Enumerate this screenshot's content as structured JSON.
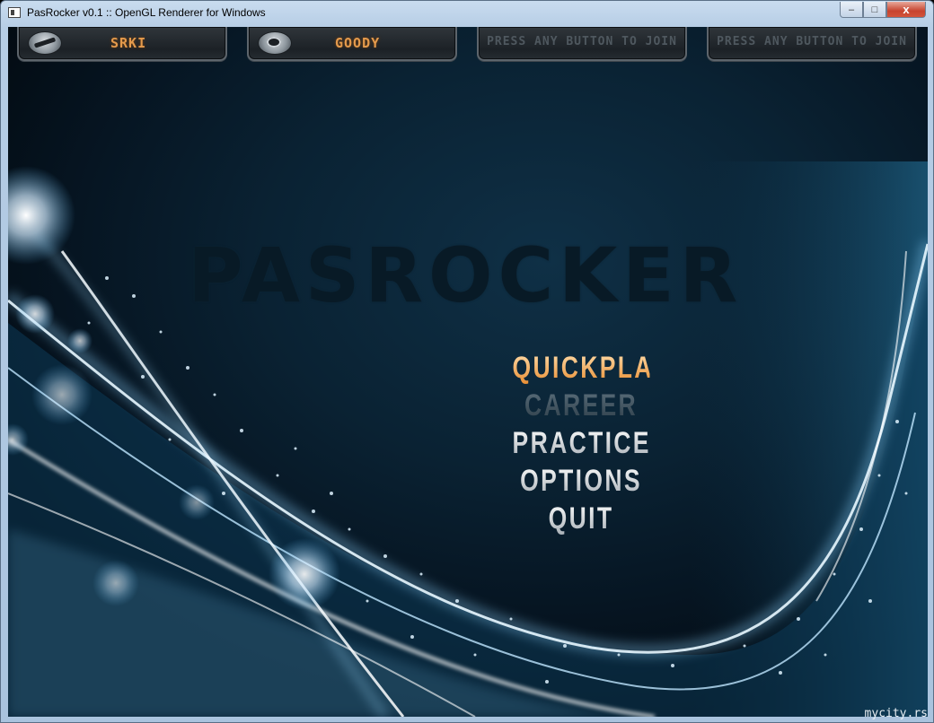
{
  "window": {
    "title": "PasRocker v0.1 :: OpenGL Renderer for Windows",
    "controls": {
      "minimize": "–",
      "maximize": "□",
      "close": "x"
    }
  },
  "players": [
    {
      "label": "SRKI",
      "icon": "guitar-icon",
      "state": "joined"
    },
    {
      "label": "GOODY",
      "icon": "drum-icon",
      "state": "joined"
    },
    {
      "label": "PRESS ANY BUTTON TO JOIN",
      "state": "empty"
    },
    {
      "label": "PRESS ANY BUTTON TO JOIN",
      "state": "empty"
    }
  ],
  "logo_text": "PASROCKER",
  "menu": {
    "items": [
      {
        "label": "QUICKPLAY",
        "state": "selected"
      },
      {
        "label": "CAREER",
        "state": "disabled"
      },
      {
        "label": "PRACTICE",
        "state": "normal"
      },
      {
        "label": "OPTIONS",
        "state": "normal"
      },
      {
        "label": "QUIT",
        "state": "normal"
      }
    ]
  },
  "watermark_credit": "mycity.rs",
  "colors": {
    "selected": "#f4a85a",
    "disabled": "#3f5563",
    "normal": "#d9dde0",
    "background": "#0a2233"
  }
}
